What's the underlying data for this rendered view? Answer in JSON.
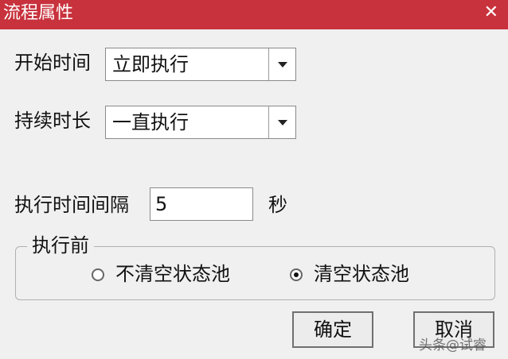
{
  "window": {
    "title": "流程属性",
    "close_glyph": "✕"
  },
  "start_time": {
    "label": "开始时间",
    "value": "立即执行"
  },
  "duration": {
    "label": "持续时长",
    "value": "一直执行"
  },
  "interval": {
    "label": "执行时间间隔",
    "value": "5",
    "unit": "秒"
  },
  "before_exec": {
    "group_label": "执行前",
    "options": [
      {
        "label": "不清空状态池",
        "selected": false
      },
      {
        "label": "清空状态池",
        "selected": true
      }
    ]
  },
  "buttons": {
    "ok": "确定",
    "cancel": "取消"
  },
  "watermark": "头条@试睿"
}
